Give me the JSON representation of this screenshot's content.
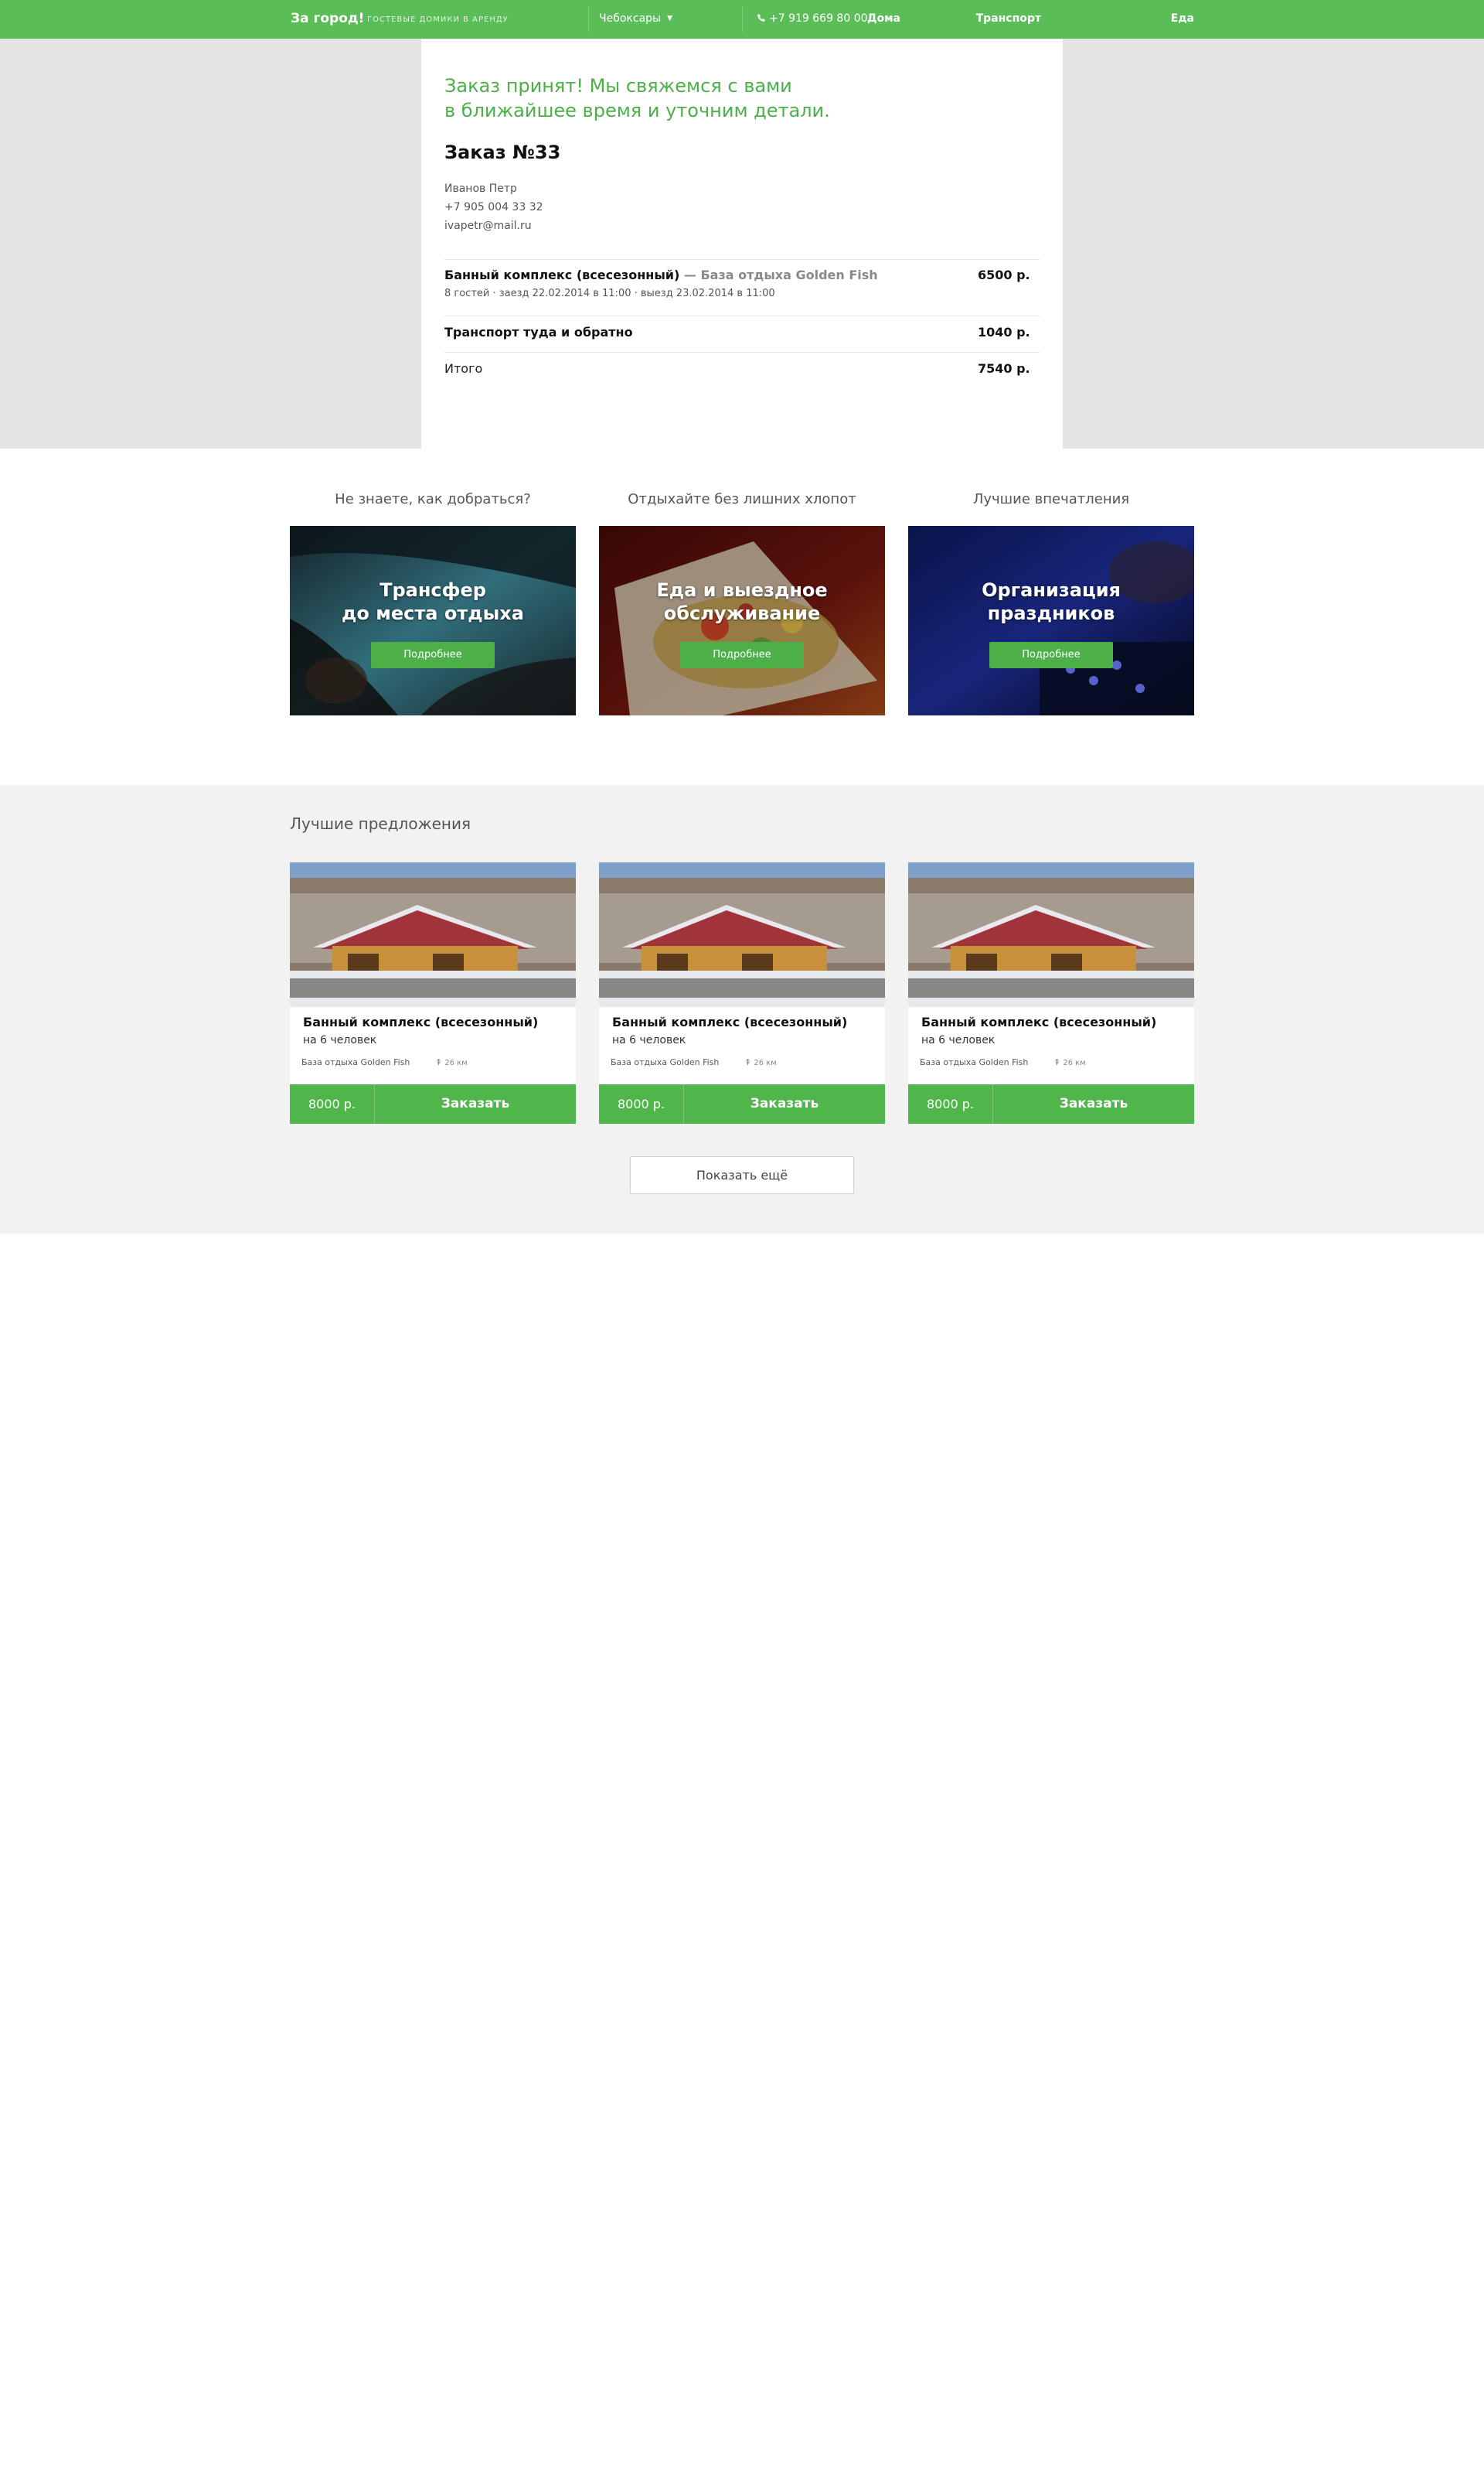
{
  "header": {
    "logo": "За город!",
    "tagline": "ГОСТЕВЫЕ ДОМИКИ В АРЕНДУ",
    "city": "Чебоксары",
    "phone": "+7 919 669 80 00",
    "nav": [
      "Дома",
      "Транспорт",
      "Еда"
    ]
  },
  "order": {
    "confirm_line1": "Заказ принят! Мы свяжемся с вами",
    "confirm_line2": "в ближайшее время и уточним детали.",
    "title": "Заказ №33",
    "customer": {
      "name": "Иванов Петр",
      "phone": "+7 905 004 33 32",
      "email": "ivapetr@mail.ru"
    },
    "items": [
      {
        "title": "Банный комплекс (всесезонный)",
        "venue": " — База отдыха Golden Fish",
        "details": "8 гостей · заезд 22.02.2014 в 11:00 · выезд 23.02.2014 в 11:00",
        "price": "6500 р."
      },
      {
        "title": "Транспорт туда и обратно",
        "price": "1040 р."
      }
    ],
    "total_label": "Итого",
    "total_price": "7540 р."
  },
  "services": [
    {
      "heading": "Не знаете, как добраться?",
      "title1": "Трансфер",
      "title2": "до места отдыха",
      "button": "Подробнее"
    },
    {
      "heading": "Отдыхайте без лишних хлопот",
      "title1": "Еда и выездное",
      "title2": "обслуживание",
      "button": "Подробнее"
    },
    {
      "heading": "Лучшие впечатления",
      "title1": "Организация",
      "title2": "праздников",
      "button": "Подробнее"
    }
  ],
  "offers": {
    "heading": "Лучшие предложения",
    "cards": [
      {
        "title": "Банный комплекс (всесезонный)",
        "capacity": "на 6 человек",
        "venue": "База отдыха Golden Fish",
        "distance": "26 км",
        "price": "8000 р.",
        "order": "Заказать"
      },
      {
        "title": "Банный комплекс (всесезонный)",
        "capacity": "на 6 человек",
        "venue": "База отдыха Golden Fish",
        "distance": "26 км",
        "price": "8000 р.",
        "order": "Заказать"
      },
      {
        "title": "Банный комплекс (всесезонный)",
        "capacity": "на 6 человек",
        "venue": "База отдыха Golden Fish",
        "distance": "26 км",
        "price": "8000 р.",
        "order": "Заказать"
      }
    ],
    "more_button": "Показать ещё"
  },
  "colors": {
    "brand_green": "#5bbd57",
    "accent_green": "#4caf48",
    "order_bg": "#e4e4e4",
    "offers_bg": "#f2f2f2"
  },
  "icons": {
    "phone": "phone-icon",
    "city_dropdown": "chevron-down-icon",
    "distance": "road-sign-icon"
  }
}
